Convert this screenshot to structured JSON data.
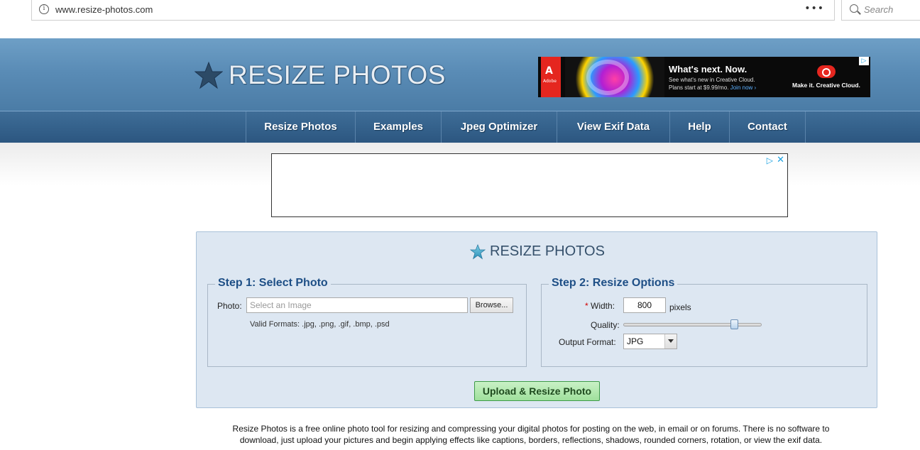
{
  "browser": {
    "url": "www.resize-photos.com",
    "info_icon_glyph": "i",
    "more_glyph": "•••",
    "search_placeholder": "Search"
  },
  "header": {
    "logo_text": "RESIZE PHOTOS",
    "logo_icon": "star-icon",
    "ad": {
      "brand_label": "Adobe",
      "brand_glyph": "A",
      "headline": "What's next. Now.",
      "subline1": "See what's new in Creative Cloud.",
      "subline2_prefix": "Plans start at $9.99/mo. ",
      "subline2_link": "Join now ›",
      "cc_tagline": "Make it. Creative Cloud.",
      "choice_glyph": "▷"
    }
  },
  "nav": {
    "items": [
      {
        "label": "Resize Photos"
      },
      {
        "label": "Examples"
      },
      {
        "label": "Jpeg Optimizer"
      },
      {
        "label": "View Exif Data"
      },
      {
        "label": "Help"
      },
      {
        "label": "Contact"
      }
    ]
  },
  "content_ad": {
    "choice_glyph": "▷",
    "close_glyph": "✕"
  },
  "tool": {
    "title": "RESIZE PHOTOS",
    "step1": {
      "legend": "Step 1: Select Photo",
      "photo_label": "Photo:",
      "file_placeholder": "Select an Image",
      "browse_label": "Browse...",
      "formats_note": "Valid Formats: .jpg, .png, .gif, .bmp, .psd"
    },
    "step2": {
      "legend": "Step 2: Resize Options",
      "required_mark": "*",
      "width_label": "Width:",
      "width_value": "800",
      "width_unit": "pixels",
      "quality_label": "Quality:",
      "quality_level": 0.82,
      "output_label": "Output Format:",
      "output_value": "JPG"
    },
    "upload_label": "Upload & Resize Photo"
  },
  "description": {
    "line1": "Resize Photos is a free online photo tool for resizing and compressing your digital photos for posting on the web, in email or on forums. There is no software to",
    "line2": "download, just upload your pictures and begin applying effects like captions, borders, reflections, shadows, rounded corners, rotation, or view the exif data."
  },
  "colors": {
    "header_blue": "#5a8cb6",
    "nav_blue": "#35628c",
    "panel_bg": "#dde7f2",
    "legend_blue": "#1e4f86",
    "upload_green": "#9fe09c"
  }
}
